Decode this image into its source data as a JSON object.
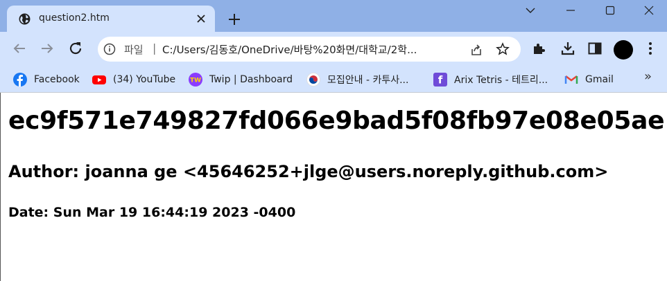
{
  "tab": {
    "title": "question2.htm",
    "favicon": "globe-icon"
  },
  "window_controls": [
    "chevron-down-icon",
    "minimize-icon",
    "maximize-icon",
    "close-icon"
  ],
  "address_bar": {
    "origin_chip": "파일",
    "url": "C:/Users/김동호/OneDrive/바탕%20화면/대학교/2학..."
  },
  "bookmarks": [
    {
      "label": "Facebook",
      "icon": "facebook-icon",
      "color": "#1877f2"
    },
    {
      "label": "(34) YouTube",
      "icon": "youtube-icon",
      "color": "#ff0000"
    },
    {
      "label": "Twip | Dashboard",
      "icon": "twip-icon",
      "color": "#8a3cff"
    },
    {
      "label": "모집안내 - 카투사...",
      "icon": "korea-flag-icon",
      "color": "#cd2e3a"
    },
    {
      "label": "Arix Tetris - 테트리...",
      "icon": "arix-icon",
      "color": "#6f4bd8"
    },
    {
      "label": "Gmail",
      "icon": "gmail-icon",
      "color": "#ea4335"
    }
  ],
  "bookmarks_more": "»",
  "page": {
    "h1": "ec9f571e749827fd066e9bad5f08fb97e08e05ae",
    "h2": "Author: joanna ge <45646252+jlge@users.noreply.github.com>",
    "h3": "Date: Sun Mar 19 16:44:19 2023 -0400"
  },
  "colors": {
    "tabstrip": "#8fb0e6",
    "toolbar": "#d3e3fd"
  }
}
